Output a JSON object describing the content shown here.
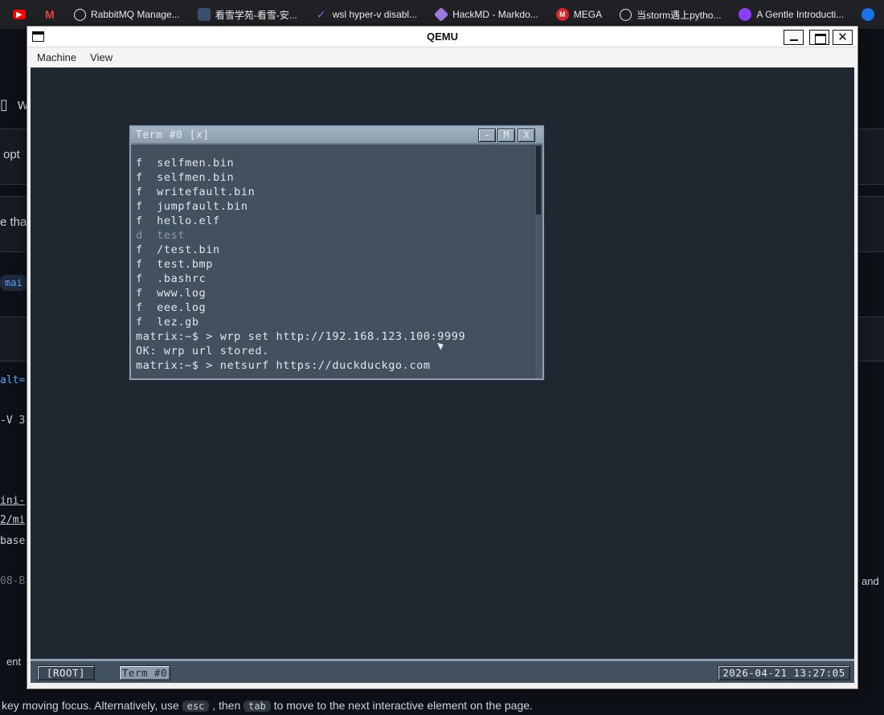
{
  "bookmarks": [
    {
      "label": "",
      "icon": "youtube-icon",
      "color": "#ff0000"
    },
    {
      "label": "",
      "icon": "gmail-icon",
      "color": "#ea4335"
    },
    {
      "label": "RabbitMQ Manage...",
      "icon": "globe-icon",
      "color": "#9aa0a6"
    },
    {
      "label": "看雪学苑-看雪-安...",
      "icon": "kanxue-icon",
      "color": "#3a4f6e"
    },
    {
      "label": "wsl hyper-v disabl...",
      "icon": "wsl-icon",
      "color": "#6b74ff"
    },
    {
      "label": "HackMD - Markdo...",
      "icon": "hackmd-icon",
      "color": "#9b7be0"
    },
    {
      "label": "MEGA",
      "icon": "mega-icon",
      "color": "#d9272e"
    },
    {
      "label": "当storm遇上pytho...",
      "icon": "globe-icon",
      "color": "#9aa0a6"
    },
    {
      "label": "A Gentle Introducti...",
      "icon": "bookmark-app-icon",
      "color": "#8a3ffc"
    }
  ],
  "background_fragments": {
    "header_text": "w",
    "opt_text": "opt",
    "that_text": "e that",
    "pill_text": "mai",
    "alt_text": "alt=",
    "v3_text": "-V 3",
    "mini_text": "ini-",
    "mi2_text": "2/mi",
    "base_text": "base",
    "b08_text": "08-B",
    "and_text": "and",
    "ent_text": "ent",
    "bottom": {
      "prefix": "key moving focus. Alternatively, use",
      "key1": "esc",
      "middle": ", then",
      "key2": "tab",
      "suffix": "to move to the next interactive element on the page."
    }
  },
  "qemu": {
    "title": "QEMU",
    "menu": [
      "Machine",
      "View"
    ],
    "close_glyph": "✕"
  },
  "guest": {
    "terminal": {
      "title": "Term #0 [x]",
      "buttons": [
        "-",
        "M",
        "X"
      ],
      "lines": [
        {
          "text": "f  selfmen.bin",
          "dim": false
        },
        {
          "text": "f  selfmen.bin",
          "dim": false
        },
        {
          "text": "f  writefault.bin",
          "dim": false
        },
        {
          "text": "f  jumpfault.bin",
          "dim": false
        },
        {
          "text": "f  hello.elf",
          "dim": false
        },
        {
          "text": "d  test",
          "dim": true
        },
        {
          "text": "f  /test.bin",
          "dim": false
        },
        {
          "text": "f  test.bmp",
          "dim": false
        },
        {
          "text": "f  .bashrc",
          "dim": false
        },
        {
          "text": "f  www.log",
          "dim": false
        },
        {
          "text": "f  eee.log",
          "dim": false
        },
        {
          "text": "f  lez.gb",
          "dim": false
        },
        {
          "text": "matrix:~$ > wrp set http://192.168.123.100:9999",
          "dim": false
        },
        {
          "text": "OK: wrp url stored.",
          "dim": false
        },
        {
          "text": "matrix:~$ > netsurf https://duckduckgo.com",
          "dim": false
        }
      ]
    },
    "taskbar": {
      "root_label": "[ROOT]",
      "term_label": "Term #0",
      "clock": "2026-04-21 13:27:05"
    }
  }
}
